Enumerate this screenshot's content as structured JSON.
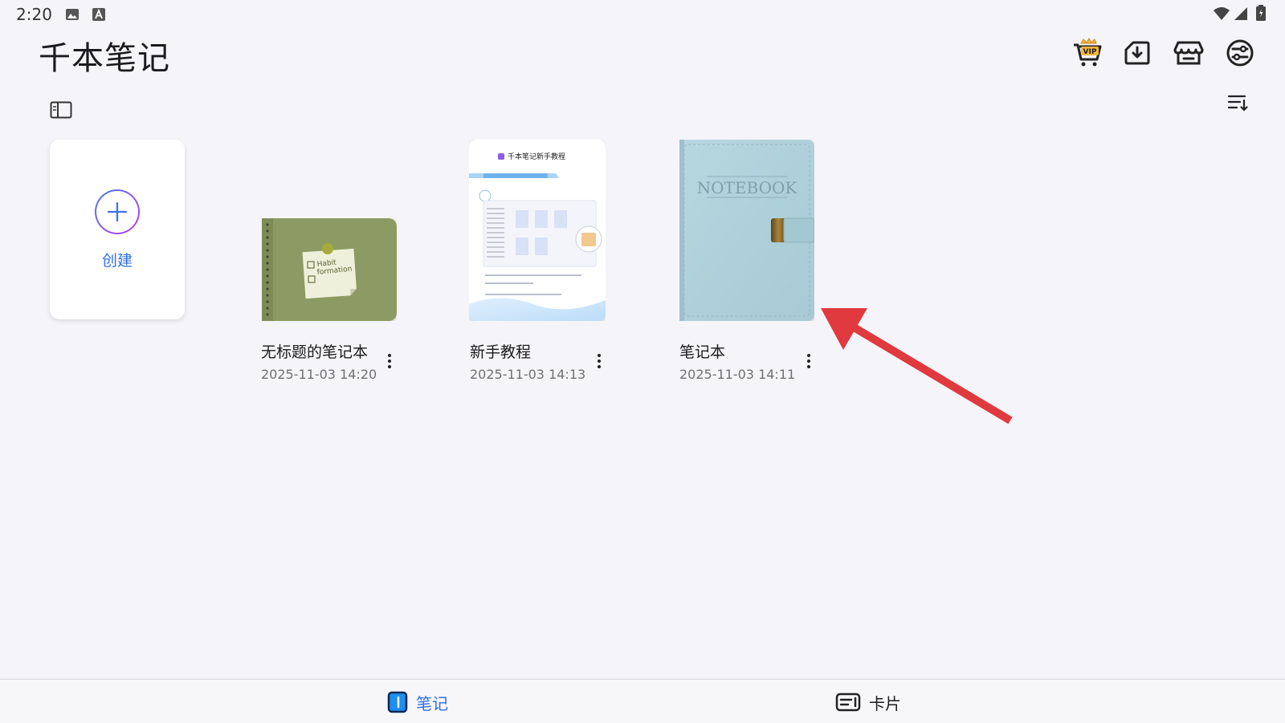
{
  "status_bar": {
    "time": "2:20"
  },
  "header": {
    "title": "千本笔记"
  },
  "toolbar": {
    "icons": [
      "vip-cart-icon",
      "import-icon",
      "store-icon",
      "settings-sliders-icon"
    ],
    "vip_text": "VIP"
  },
  "subbar": {
    "left_icon": "sidebar-toggle-icon",
    "right_icon": "sort-icon"
  },
  "create_card": {
    "label": "创建"
  },
  "notebooks": [
    {
      "name": "无标题的笔记本",
      "date": "2025-11-03 14:20",
      "cover_text": "Habit formation"
    },
    {
      "name": "新手教程",
      "date": "2025-11-03 14:13",
      "cover_text": "千本笔记新手教程"
    },
    {
      "name": "笔记本",
      "date": "2025-11-03 14:11",
      "cover_text": "NOTEBOOK"
    }
  ],
  "bottom_nav": [
    {
      "label": "笔记",
      "active": true
    },
    {
      "label": "卡片",
      "active": false
    }
  ],
  "colors": {
    "accent": "#2f6fe4",
    "arrow": "#e0393e",
    "background": "#f5f4f9"
  }
}
